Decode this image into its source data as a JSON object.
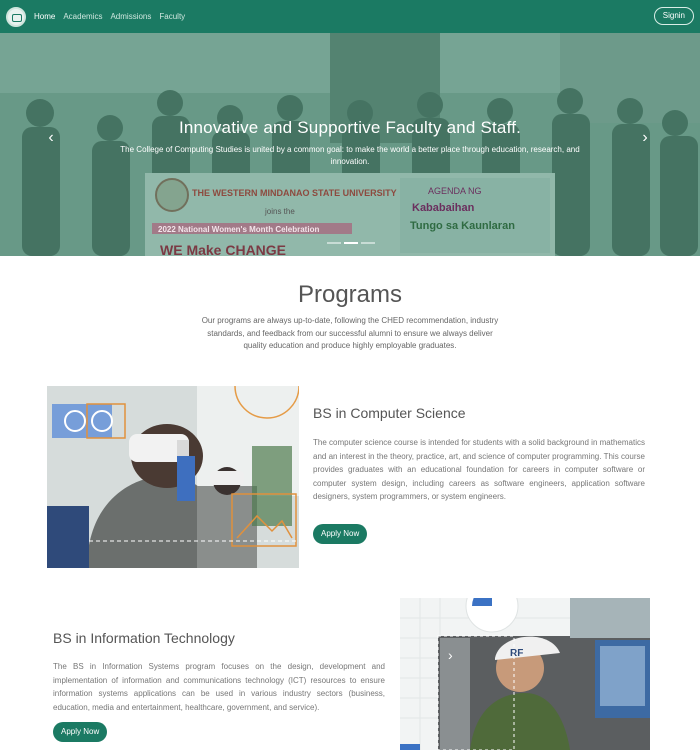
{
  "navbar": {
    "logo_icon": "ccs-logo-icon",
    "links": [
      "Home",
      "Academics",
      "Admissions",
      "Faculty"
    ],
    "signin_label": "Signin",
    "background": "#1b7a63"
  },
  "hero": {
    "title": "Innovative and Supportive Faculty and Staff.",
    "subtitle": "The College of Computing Studies is united by a common goal: to make the world a better place through education, research, and innovation.",
    "prev_icon": "chevron-left-icon",
    "next_icon": "chevron-right-icon",
    "indicator_count": 3,
    "active_indicator": 1,
    "banner_texts": {
      "university": "THE WESTERN MINDANAO STATE UNIVERSITY",
      "joins": "joins the",
      "celebration": "2022 National Women's Month Celebration",
      "slogan": "WE Make CHANGE",
      "agenda": "AGENDA NG",
      "kababaihan": "Kababaihan",
      "tungo": "Tungo sa Kaunlaran"
    }
  },
  "programs": {
    "title": "Programs",
    "description": "Our programs are always up-to-date, following the CHED recommendation, industry standards, and feedback from our successful alumni to ensure we always deliver quality education and produce highly employable graduates.",
    "items": [
      {
        "title": "BS in Computer Science",
        "description": "The computer science course is intended for students with a solid background in mathematics and an interest in the theory, practice, art, and science of computer programming. This course provides graduates with an educational foundation for careers in computer software or computer system design, including careers as software engineers, application software designers, system programmers, or system engineers.",
        "apply_label": "Apply Now"
      },
      {
        "title": "BS in Information Technology",
        "description": "The BS in Information Systems program focuses on the design, development and implementation of information and communications technology (ICT) resources to ensure information systems applications can be used in various industry sectors (business, education, media and entertainment, healthcare, government, and service).",
        "apply_label": "Apply Now"
      }
    ]
  },
  "colors": {
    "brand": "#1b7a63",
    "hero_overlay": "rgba(38,120,95,0.45)"
  }
}
